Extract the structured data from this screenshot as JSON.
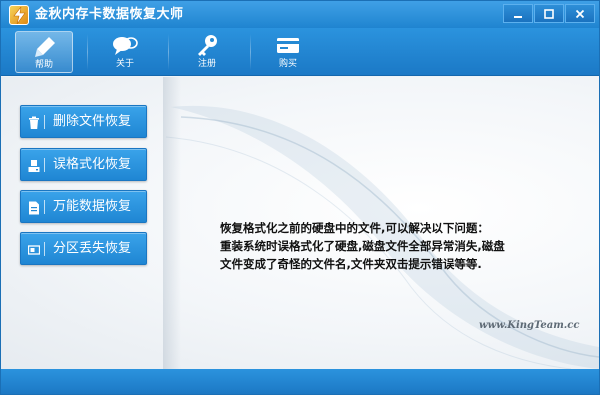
{
  "window": {
    "title": "金秋内存卡数据恢复大师",
    "controls": [
      "minimize-icon",
      "maximize-icon",
      "close-icon"
    ]
  },
  "toolbar": {
    "items": [
      {
        "label": "帮助",
        "icon": "pen-brush-icon",
        "active": true
      },
      {
        "label": "关于",
        "icon": "chat-bubbles-icon",
        "active": false
      },
      {
        "label": "注册",
        "icon": "key-icon",
        "active": false
      },
      {
        "label": "购买",
        "icon": "card-icon",
        "active": false
      }
    ]
  },
  "sidebar": {
    "buttons": [
      {
        "label": "删除文件恢复",
        "icon": "trash-icon"
      },
      {
        "label": "误格式化恢复",
        "icon": "disk-icon"
      },
      {
        "label": "万能数据恢复",
        "icon": "document-icon"
      },
      {
        "label": "分区丢失恢复",
        "icon": "partition-icon"
      }
    ]
  },
  "content": {
    "lines": [
      "恢复格式化之前的硬盘中的文件,可以解决以下问题：",
      "重装系统时误格式化了硬盘,磁盘文件全部异常消失,磁盘",
      "文件变成了奇怪的文件名,文件夹双击提示错误等等."
    ],
    "watermark": "www.KingTeam.cc"
  },
  "colors": {
    "accent": "#1f86d3",
    "titlebar": "#2b93de",
    "text": "#111111"
  }
}
